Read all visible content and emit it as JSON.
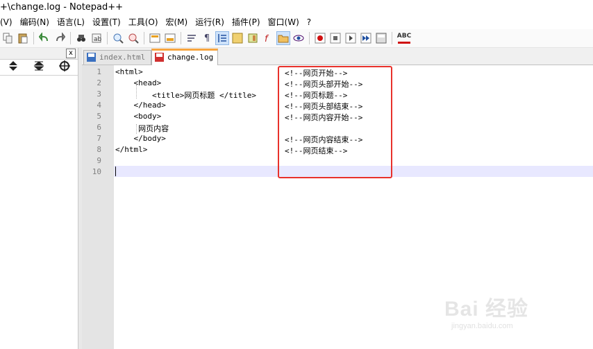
{
  "window": {
    "title": "+\\change.log - Notepad++"
  },
  "menu": [
    "(V)",
    "编码(N)",
    "语言(L)",
    "设置(T)",
    "工具(O)",
    "宏(M)",
    "运行(R)",
    "插件(P)",
    "窗口(W)",
    "?"
  ],
  "toolbar": {
    "spellcheck_label": "ABC"
  },
  "left_panel": {
    "close_glyph": "x"
  },
  "tabs": [
    {
      "label": "index.html",
      "active": false,
      "icon": "saved-file-icon"
    },
    {
      "label": "change.log",
      "active": true,
      "icon": "modified-file-icon"
    }
  ],
  "editor": {
    "line_numbers": [
      "1",
      "2",
      "3",
      "4",
      "5",
      "6",
      "7",
      "8",
      "9",
      "10"
    ],
    "lines": [
      {
        "code": "<html>",
        "comment": "<!--网页开始-->"
      },
      {
        "code": "    <head>",
        "comment": "<!--网页头部开始-->"
      },
      {
        "code": "        <title>网页标题 </title>",
        "comment": "<!--网页标题-->"
      },
      {
        "code": "    </head>",
        "comment": "<!--网页头部结束-->"
      },
      {
        "code": "    <body>",
        "comment": "<!--网页内容开始-->"
      },
      {
        "code": "     网页内容",
        "comment": ""
      },
      {
        "code": "    </body>",
        "comment": "<!--网页内容结束-->"
      },
      {
        "code": "</html>",
        "comment": "<!--网页结束-->"
      },
      {
        "code": "",
        "comment": ""
      },
      {
        "code": "",
        "comment": ""
      }
    ],
    "current_line": 10
  },
  "watermark": {
    "brand": "Bai 经验",
    "site": "jingyan.baidu.com"
  },
  "colors": {
    "highlight_box": "#e8312b",
    "active_tab_accent": "#f8a53e",
    "current_line": "#e8e8ff"
  }
}
